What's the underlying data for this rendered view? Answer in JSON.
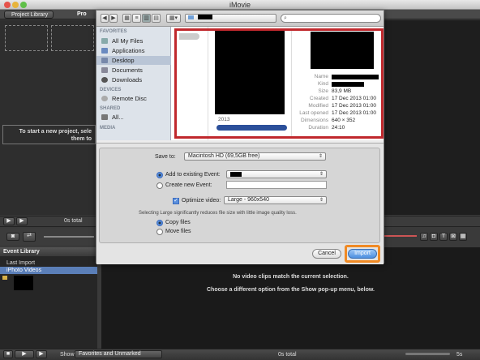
{
  "app": {
    "title": "iMovie"
  },
  "toolbar": {
    "project_library": "Project Library",
    "project_tab": "Pro"
  },
  "left_pane": {
    "start_text_1": "To start a new project, sele",
    "start_text_2": "them to"
  },
  "controls": {
    "total_top": "0s total",
    "total_bottom": "0s total",
    "zoom": "5s"
  },
  "event_library": {
    "title": "Event Library",
    "items": [
      "Last Import",
      "iPhoto Videos"
    ]
  },
  "event_message": {
    "line1": "No video clips match the current selection.",
    "line2": "Choose a different option from the Show pop-up menu, below."
  },
  "bottom": {
    "show_label": "Show:",
    "show_value": "Favorites and Unmarked"
  },
  "dialog": {
    "search_placeholder": "",
    "sidebar": {
      "favorites_header": "FAVORITES",
      "favorites": [
        "All My Files",
        "Applications",
        "Desktop",
        "Documents",
        "Downloads"
      ],
      "devices_header": "DEVICES",
      "devices": [
        "Remote Disc"
      ],
      "shared_header": "SHARED",
      "shared": [
        "All..."
      ],
      "media_header": "MEDIA"
    },
    "browser": {
      "year": "2013"
    },
    "preview": {
      "meta": [
        {
          "k": "Name",
          "v": ""
        },
        {
          "k": "Kind",
          "v": ""
        },
        {
          "k": "Size",
          "v": "83,9 MB"
        },
        {
          "k": "Created",
          "v": "17 Dec 2013 01:00"
        },
        {
          "k": "Modified",
          "v": "17 Dec 2013 01:00"
        },
        {
          "k": "Last opened",
          "v": "17 Dec 2013 01:00"
        },
        {
          "k": "Dimensions",
          "v": "640 × 352"
        },
        {
          "k": "Duration",
          "v": "24:10"
        }
      ]
    },
    "form": {
      "save_to_label": "Save to:",
      "save_to_value": "Macintosh HD (69,5GB free)",
      "add_existing": "Add to existing Event:",
      "create_new": "Create new Event:",
      "optimize_label": "Optimize video:",
      "optimize_value": "Large - 960x540",
      "hint": "Selecting Large significantly reduces file size with little image quality loss.",
      "copy_files": "Copy files",
      "move_files": "Move files"
    },
    "buttons": {
      "cancel": "Cancel",
      "import": "Import"
    }
  },
  "colors": {
    "highlight": "#c0282d",
    "import_ring": "#f08a24",
    "accent": "#5a8fdc"
  }
}
